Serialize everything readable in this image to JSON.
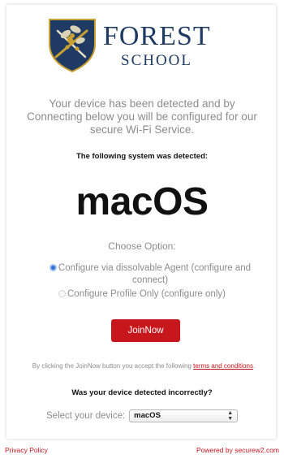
{
  "brand": {
    "name_line1": "FOREST",
    "name_line2": "SCHOOL",
    "navy": "#1f3a63",
    "gold": "#c9a132"
  },
  "intro_text": "Your device has been detected and by Connecting below you will be configured for our secure Wi-Fi Service.",
  "detected_label": "The following system was detected:",
  "detected_os": "macOS",
  "choose_label": "Choose Option:",
  "options": [
    {
      "label": "Configure via dissolvable Agent (configure and connect)",
      "selected": true
    },
    {
      "label": "Configure Profile Only (configure only)",
      "selected": false
    }
  ],
  "join_button": {
    "label": "JoinNow",
    "color": "#c8161d"
  },
  "terms": {
    "prefix": "By clicking the JoinNow button you accept the following ",
    "link_text": "terms and conditions",
    "suffix": "."
  },
  "incorrect_label": "Was your device detected incorrectly?",
  "device_select": {
    "label": "Select your device:",
    "value": "macOS"
  },
  "footer": {
    "privacy_link": "Privacy Policy",
    "powered_by": "Powered by securew2.com"
  }
}
